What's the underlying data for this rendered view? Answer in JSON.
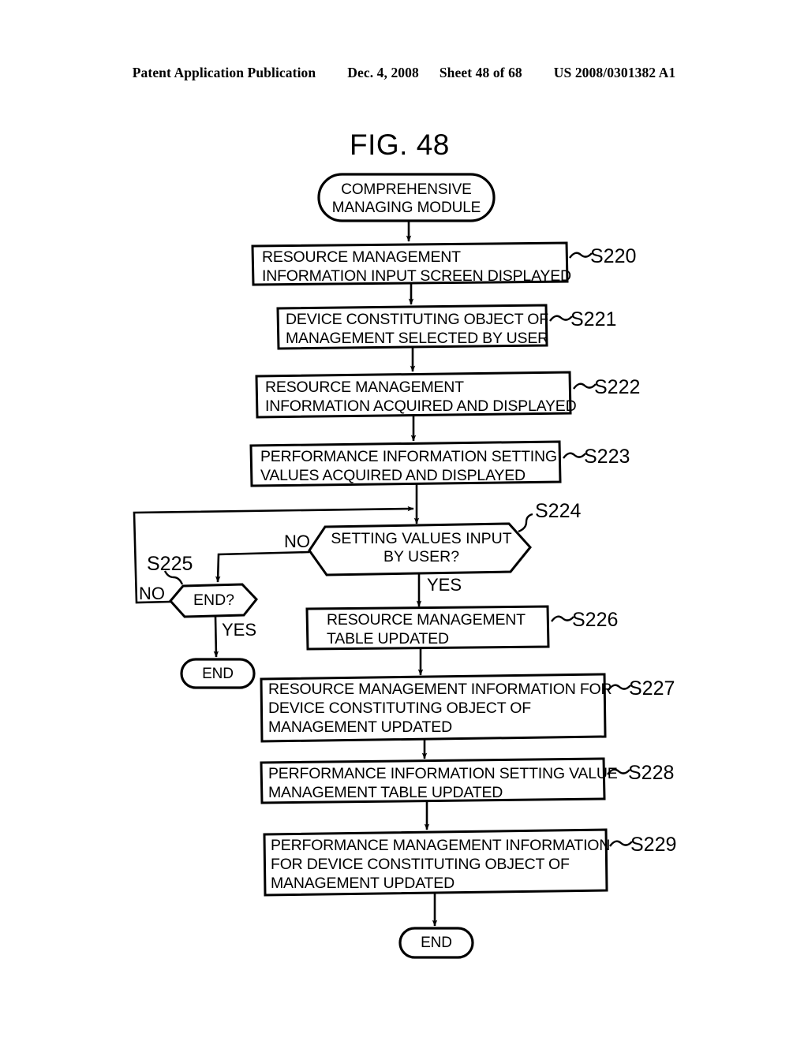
{
  "header": {
    "publication": "Patent Application Publication",
    "date": "Dec. 4, 2008",
    "sheet": "Sheet 48 of 68",
    "patent_number": "US 2008/0301382 A1"
  },
  "figure": {
    "title": "FIG. 48"
  },
  "flowchart": {
    "start_terminator": {
      "line1": "COMPREHENSIVE",
      "line2": "MANAGING MODULE"
    },
    "steps": [
      {
        "id": "S220",
        "label": "S220",
        "line1": "RESOURCE MANAGEMENT",
        "line2": "INFORMATION INPUT SCREEN DISPLAYED",
        "line3": ""
      },
      {
        "id": "S221",
        "label": "S221",
        "line1": "DEVICE CONSTITUTING OBJECT OF",
        "line2": "MANAGEMENT SELECTED BY USER",
        "line3": ""
      },
      {
        "id": "S222",
        "label": "S222",
        "line1": "RESOURCE MANAGEMENT",
        "line2": "INFORMATION ACQUIRED AND DISPLAYED",
        "line3": ""
      },
      {
        "id": "S223",
        "label": "S223",
        "line1": "PERFORMANCE INFORMATION SETTING",
        "line2": "VALUES ACQUIRED AND DISPLAYED",
        "line3": ""
      },
      {
        "id": "S226",
        "label": "S226",
        "line1": "RESOURCE MANAGEMENT",
        "line2": "TABLE UPDATED",
        "line3": ""
      },
      {
        "id": "S227",
        "label": "S227",
        "line1": "RESOURCE MANAGEMENT INFORMATION FOR",
        "line2": "DEVICE CONSTITUTING OBJECT OF",
        "line3": "MANAGEMENT UPDATED"
      },
      {
        "id": "S228",
        "label": "S228",
        "line1": "PERFORMANCE INFORMATION SETTING VALUE",
        "line2": "MANAGEMENT TABLE UPDATED",
        "line3": ""
      },
      {
        "id": "S229",
        "label": "S229",
        "line1": "PERFORMANCE MANAGEMENT INFORMATION",
        "line2": "FOR DEVICE CONSTITUTING OBJECT OF",
        "line3": "MANAGEMENT UPDATED"
      }
    ],
    "decisions": [
      {
        "id": "S224",
        "label": "S224",
        "line1": "SETTING VALUES INPUT",
        "line2": "BY USER?",
        "no_label": "NO",
        "yes_label": "YES"
      },
      {
        "id": "S225",
        "label": "S225",
        "line1": "END?",
        "line2": "",
        "no_label": "NO",
        "yes_label": "YES"
      }
    ],
    "end_terminators": [
      {
        "id": "end-left",
        "text": "END"
      },
      {
        "id": "end-bottom",
        "text": "END"
      }
    ]
  }
}
